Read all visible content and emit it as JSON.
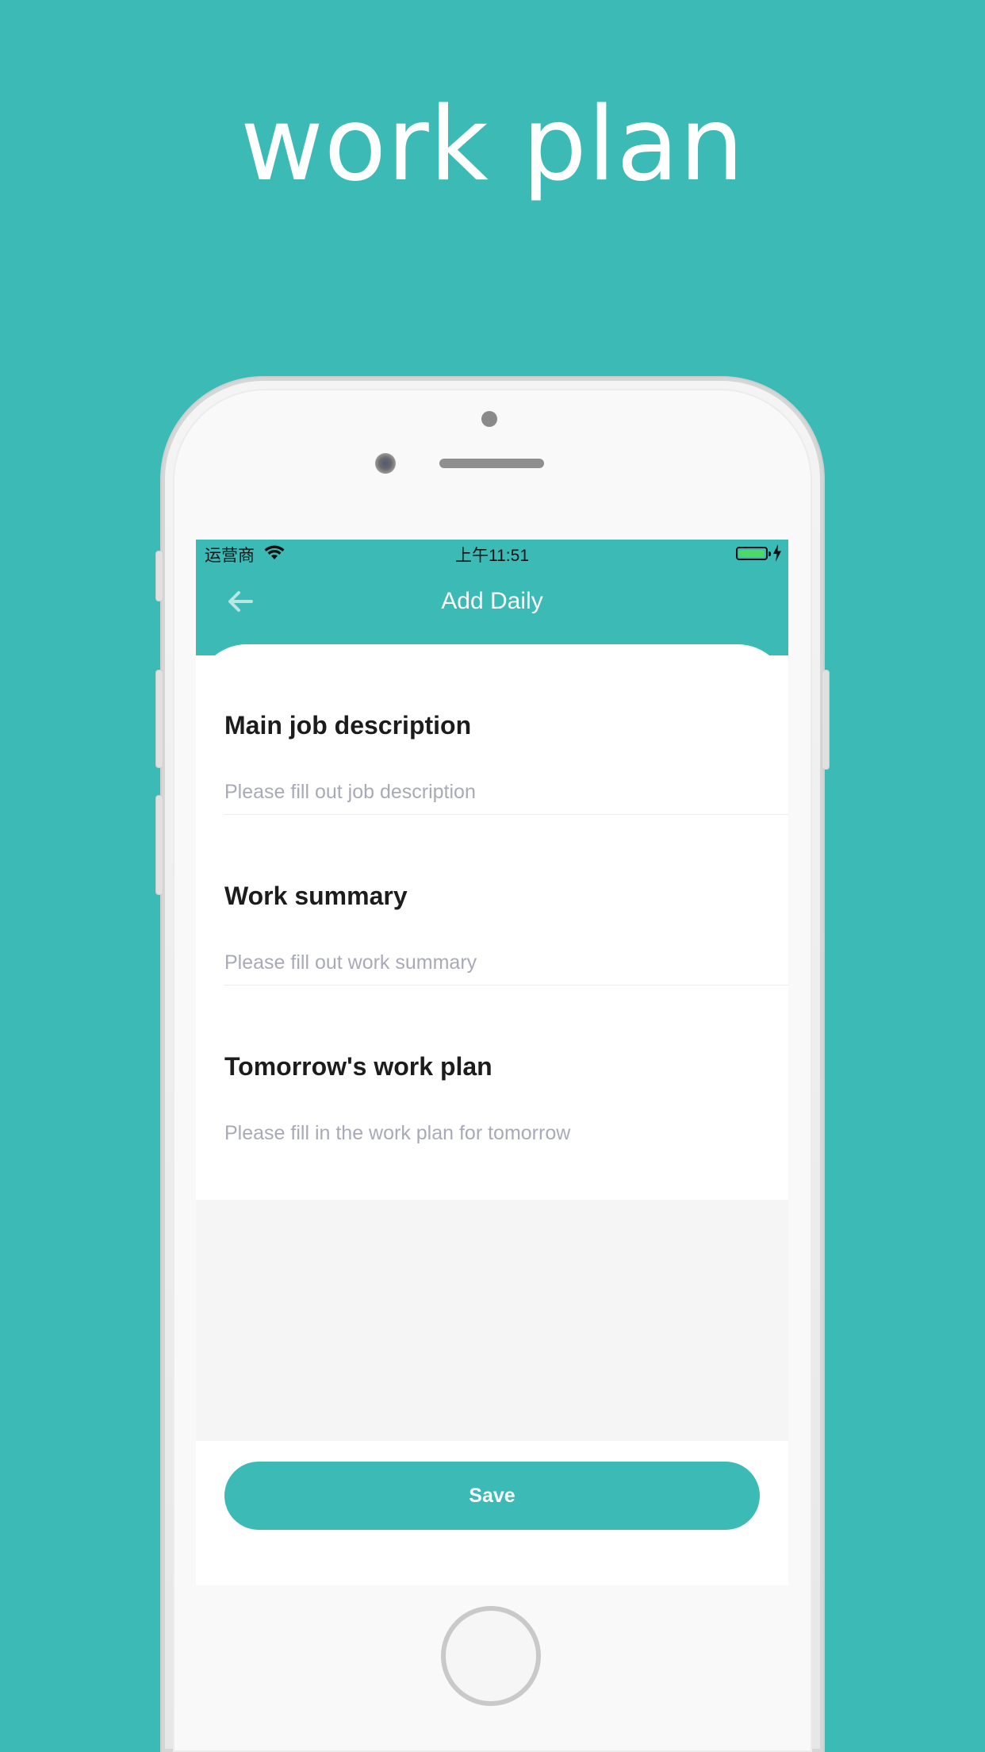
{
  "headline": "work plan",
  "status_bar": {
    "carrier": "运营商",
    "time": "上午11:51"
  },
  "nav": {
    "title": "Add Daily"
  },
  "sections": [
    {
      "title": "Main job description",
      "placeholder": "Please fill out job description"
    },
    {
      "title": "Work summary",
      "placeholder": "Please fill out work summary"
    },
    {
      "title": "Tomorrow's work plan",
      "placeholder": "Please fill in the work plan for tomorrow"
    }
  ],
  "footer": {
    "save_label": "Save"
  },
  "colors": {
    "accent": "#3bbab6",
    "background": "#3bbab6",
    "placeholder": "#a9aab8",
    "battery": "#4cd964"
  },
  "icons": {
    "back": "arrow-left-icon",
    "wifi": "wifi-icon",
    "battery": "battery-icon",
    "charging": "bolt-icon"
  }
}
